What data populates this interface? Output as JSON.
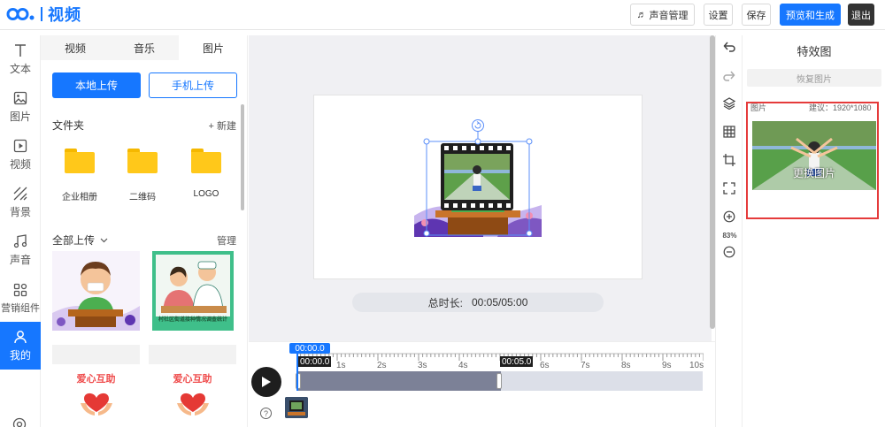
{
  "app": {
    "logo_text": "视频"
  },
  "toolbar": {
    "sound_label": "声音管理",
    "settings_label": "设置",
    "save_label": "保存",
    "preview_label": "预览和生成",
    "exit_label": "退出"
  },
  "rail": {
    "items": [
      {
        "label": "文本",
        "icon": "text-icon"
      },
      {
        "label": "图片",
        "icon": "image-icon"
      },
      {
        "label": "视频",
        "icon": "video-icon"
      },
      {
        "label": "背景",
        "icon": "background-icon"
      },
      {
        "label": "声音",
        "icon": "music-note-icon"
      },
      {
        "label": "营销组件",
        "icon": "widgets-icon"
      },
      {
        "label": "我的",
        "icon": "user-icon",
        "active": true
      }
    ],
    "bottom_icon": "help-icon"
  },
  "panel": {
    "tabs": [
      {
        "label": "视频"
      },
      {
        "label": "音乐"
      },
      {
        "label": "图片",
        "active": true
      }
    ],
    "upload_local": "本地上传",
    "upload_phone": "手机上传",
    "folders_title": "文件夹",
    "new_folder": "+ 新建",
    "folders": [
      {
        "label": "企业相册"
      },
      {
        "label": "二维码"
      },
      {
        "label": "LOGO"
      }
    ],
    "uploads_filter": "全部上传",
    "manage_label": "管理",
    "thumbs": [
      {
        "caption": ""
      },
      {
        "caption": "村社区街道接种情况调查统计"
      },
      {
        "caption": "爱心互助"
      },
      {
        "caption": "爱心互助"
      }
    ]
  },
  "stage": {
    "duration_label": "总时长:",
    "duration_value": "00:05/05:00"
  },
  "tools": {
    "zoom": "83%",
    "items": [
      "undo-icon",
      "redo-icon",
      "layers-icon",
      "grid-icon",
      "crop-icon",
      "fullscreen-icon",
      "zoom-in-icon",
      "zoom-out-icon"
    ]
  },
  "effect": {
    "title": "特效图",
    "restore_label": "恢复图片",
    "image_label": "图片",
    "size_hint": "建议：1920*1080",
    "replace_label": "更换图片"
  },
  "timeline": {
    "cursor_time": "00:00.0",
    "start_pill": "00:00.0",
    "end_pill": "00:05.0",
    "ticks": [
      "1s",
      "2s",
      "3s",
      "4s",
      "6s",
      "7s",
      "8s",
      "9s",
      "10s"
    ]
  }
}
